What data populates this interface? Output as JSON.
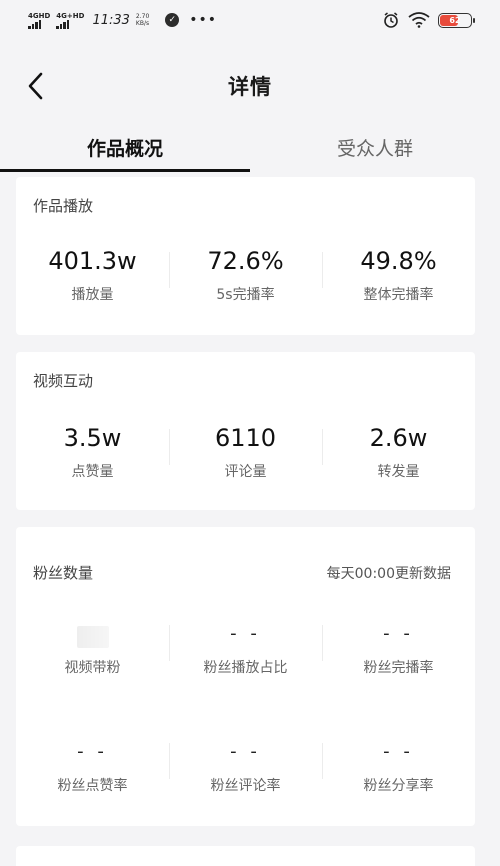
{
  "status_bar": {
    "network_1": "4GHD",
    "network_2": "4G+HD",
    "time": "11:33",
    "speed_value": "2.70",
    "speed_unit": "KB/s",
    "battery_level": "62"
  },
  "nav": {
    "title": "详情"
  },
  "tabs": [
    {
      "label": "作品概况",
      "active": true
    },
    {
      "label": "受众人群",
      "active": false
    }
  ],
  "play_card": {
    "title": "作品播放",
    "stats": [
      {
        "value": "401.3w",
        "label": "播放量"
      },
      {
        "value": "72.6%",
        "label": "5s完播率"
      },
      {
        "value": "49.8%",
        "label": "整体完播率"
      }
    ]
  },
  "interaction_card": {
    "title": "视频互动",
    "stats": [
      {
        "value": "3.5w",
        "label": "点赞量"
      },
      {
        "value": "6110",
        "label": "评论量"
      },
      {
        "value": "2.6w",
        "label": "转发量"
      }
    ]
  },
  "fans_card": {
    "title": "粉丝数量",
    "note": "每天00:00更新数据",
    "row1": [
      {
        "value": "",
        "label": "视频带粉"
      },
      {
        "value": "- -",
        "label": "粉丝播放占比"
      },
      {
        "value": "- -",
        "label": "粉丝完播率"
      }
    ],
    "row2": [
      {
        "value": "- -",
        "label": "粉丝点赞率"
      },
      {
        "value": "- -",
        "label": "粉丝评论率"
      },
      {
        "value": "- -",
        "label": "粉丝分享率"
      }
    ]
  },
  "colors": {
    "background": "#f4f4f6",
    "card": "#ffffff",
    "text_primary": "#111111",
    "text_secondary": "#666666",
    "battery": "#e84b3c"
  }
}
